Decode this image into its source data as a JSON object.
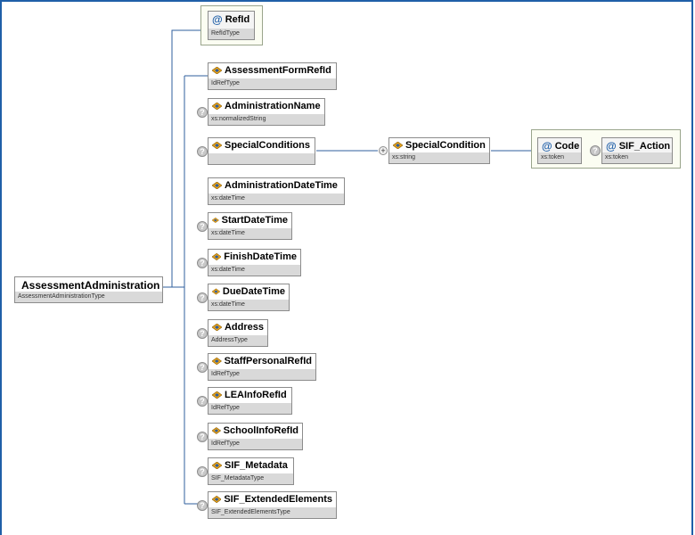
{
  "root": {
    "name": "AssessmentAdministration",
    "type": "AssessmentAdministrationType"
  },
  "refid": {
    "name": "RefId",
    "type": "RefIdType"
  },
  "elements": [
    {
      "name": "AssessmentFormRefId",
      "type": "IdRefType"
    },
    {
      "name": "AdministrationName",
      "type": "xs:normalizedString"
    },
    {
      "name": "SpecialConditions",
      "type": ""
    },
    {
      "name": "AdministrationDateTime",
      "type": "xs:dateTime"
    },
    {
      "name": "StartDateTime",
      "type": "xs:dateTime"
    },
    {
      "name": "FinishDateTime",
      "type": "xs:dateTime"
    },
    {
      "name": "DueDateTime",
      "type": "xs:dateTime"
    },
    {
      "name": "Address",
      "type": "AddressType"
    },
    {
      "name": "StaffPersonalRefId",
      "type": "IdRefType"
    },
    {
      "name": "LEAInfoRefId",
      "type": "IdRefType"
    },
    {
      "name": "SchoolInfoRefId",
      "type": "IdRefType"
    },
    {
      "name": "SIF_Metadata",
      "type": "SIF_MetadataType"
    },
    {
      "name": "SIF_ExtendedElements",
      "type": "SIF_ExtendedElementsType"
    }
  ],
  "special_condition": {
    "name": "SpecialCondition",
    "type": "xs:string"
  },
  "code": {
    "name": "Code",
    "type": "xs:token"
  },
  "sif_action": {
    "name": "SIF_Action",
    "type": "xs:token"
  },
  "icons": {
    "optional": "?",
    "expand": "+",
    "attribute": "@"
  }
}
